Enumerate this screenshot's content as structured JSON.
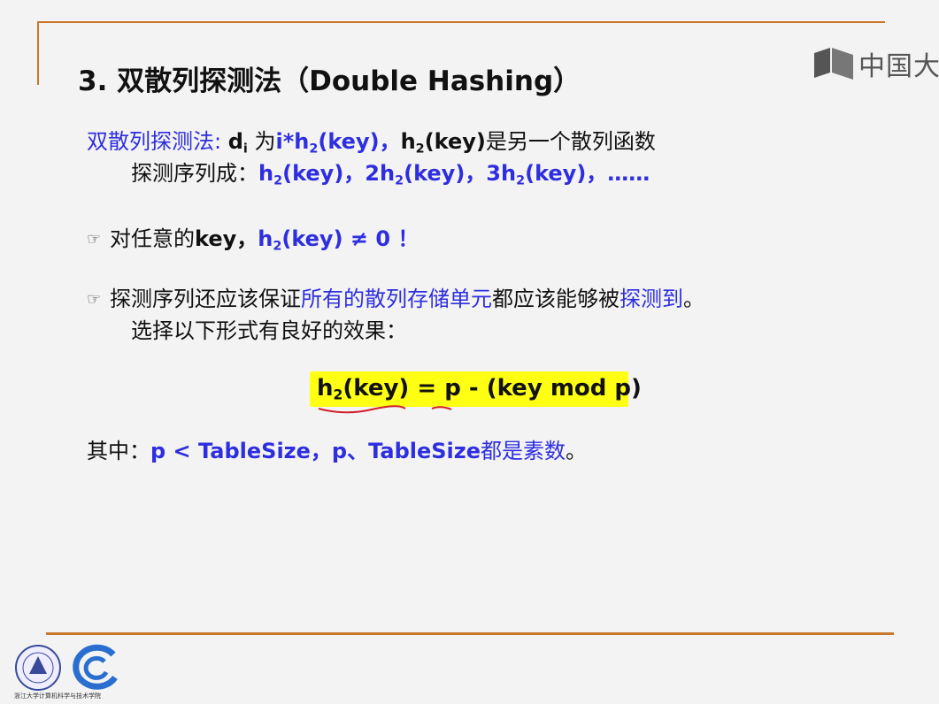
{
  "slide": {
    "title": "3. 双散列探测法（Double Hashing）",
    "watermark_text": "中国大",
    "line1": {
      "prefix": "双散列探测法:",
      "d": "d",
      "d_sub": "i",
      "wei": "为",
      "i_h": "i*h",
      "i_h_sub": "2",
      "i_h_tail": "(key)，",
      "h2": "h",
      "h2_sub": "2",
      "h2_tail": "(key)",
      "suffix": "是另一个散列函数"
    },
    "line2": {
      "prefix": "探测序列成：",
      "a": "h",
      "a_sub": "2",
      "a_tail": "(key)，",
      "b": "2h",
      "b_sub": "2",
      "b_tail": "(key)，",
      "c": "3h",
      "c_sub": "2",
      "c_tail": "(key)，",
      "dots": "……"
    },
    "bullet_icon": "pointing-hand-icon",
    "line3": {
      "prefix": "对任意的",
      "key": "key，",
      "h": "h",
      "h_sub": "2",
      "h_tail": "(key) ≠ 0 ！"
    },
    "line4": {
      "part1": "探测序列还应该保证",
      "part2": "所有的散列存储单元",
      "part3": "都应该能够被",
      "part4": "探测到",
      "part5": "。"
    },
    "line5": "选择以下形式有良好的效果：",
    "formula": {
      "h": "h",
      "sub": "2",
      "tail": "(key) = p - (key mod p)"
    },
    "line7": {
      "prefix": "其中：",
      "cond": "p < TableSize，p、TableSize",
      "suffix": "都是素数",
      "end": "。"
    },
    "logo_caption": "浙江大学计算机科学与技术学院"
  },
  "colors": {
    "accent_rule": "#c8782a",
    "blue_text": "#2e2ee0",
    "highlight": "#ffff14",
    "annotation_red": "#d0202a"
  }
}
